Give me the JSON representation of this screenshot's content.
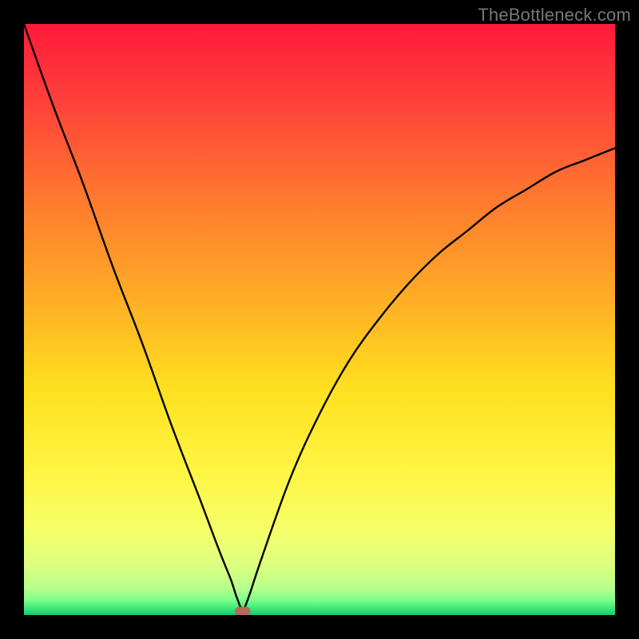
{
  "watermark": "TheBottleneck.com",
  "chart_data": {
    "type": "line",
    "title": "",
    "xlabel": "",
    "ylabel": "",
    "xlim": [
      0,
      100
    ],
    "ylim": [
      0,
      100
    ],
    "note": "Vertical gradient background red→yellow→green with a thin green band at the bottom; single black curve showing an asymmetric V-shaped dip touching the bottom near x≈37; small rounded marker at the minimum.",
    "series": [
      {
        "name": "curve",
        "x": [
          0,
          5,
          10,
          15,
          20,
          25,
          30,
          33,
          35,
          36,
          37,
          38,
          40,
          45,
          50,
          55,
          60,
          65,
          70,
          75,
          80,
          85,
          90,
          95,
          100
        ],
        "y": [
          100,
          86,
          73,
          59,
          46,
          32,
          19,
          11,
          6,
          3,
          1,
          3,
          9,
          23,
          34,
          43,
          50,
          56,
          61,
          65,
          69,
          72,
          75,
          77,
          79
        ]
      }
    ],
    "marker": {
      "x": 37,
      "y": 0.6
    },
    "gradient_stops": [
      {
        "offset": 0.0,
        "color": "#ff1a3b"
      },
      {
        "offset": 0.12,
        "color": "#ff3d3a"
      },
      {
        "offset": 0.3,
        "color": "#ff7a2f"
      },
      {
        "offset": 0.48,
        "color": "#ffb224"
      },
      {
        "offset": 0.62,
        "color": "#ffe11f"
      },
      {
        "offset": 0.76,
        "color": "#fff544"
      },
      {
        "offset": 0.86,
        "color": "#f5ff6a"
      },
      {
        "offset": 0.92,
        "color": "#d9ff82"
      },
      {
        "offset": 0.955,
        "color": "#b6ff8c"
      },
      {
        "offset": 0.975,
        "color": "#7dff8a"
      },
      {
        "offset": 0.99,
        "color": "#34e67a"
      },
      {
        "offset": 1.0,
        "color": "#18c86a"
      }
    ],
    "marker_color": "#b46a5a"
  }
}
